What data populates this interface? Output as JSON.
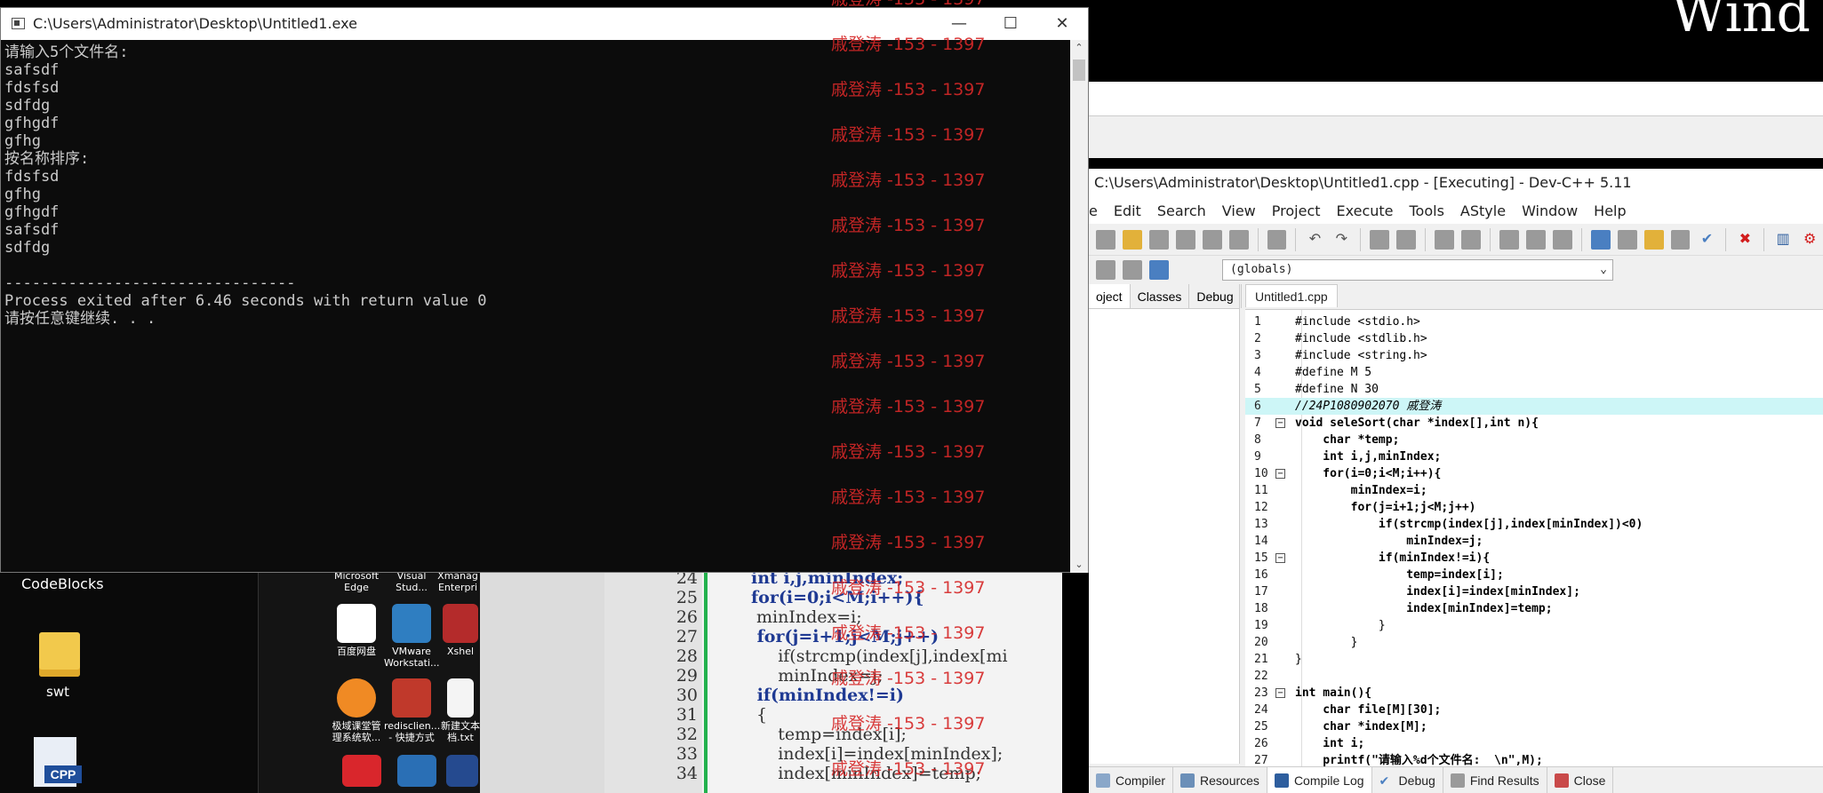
{
  "console": {
    "title": "C:\\Users\\Administrator\\Desktop\\Untitled1.exe",
    "lines": [
      "请输入5个文件名:",
      "safsdf",
      "fdsfsd",
      "sdfdg",
      "gfhgdf",
      "gfhg",
      "按名称排序:",
      "fdsfsd",
      "gfhg",
      "gfhgdf",
      "safsdf",
      "sdfdg",
      "",
      "--------------------------------",
      "Process exited after 6.46 seconds with return value 0",
      "请按任意键继续. . ."
    ],
    "minimize": "—",
    "maximize": "☐",
    "close": "✕"
  },
  "watermark": {
    "text": "戚登涛 -153 - 1397"
  },
  "devcpp": {
    "title": "C:\\Users\\Administrator\\Desktop\\Untitled1.cpp - [Executing] - Dev-C++ 5.11",
    "menu": [
      "e",
      "Edit",
      "Search",
      "View",
      "Project",
      "Execute",
      "Tools",
      "AStyle",
      "Window",
      "Help"
    ],
    "globals": "(globals)",
    "left_tabs": [
      "oject",
      "Classes",
      "Debug"
    ],
    "file_tab": "Untitled1.cpp",
    "code": [
      {
        "n": "1",
        "t": "#include <stdio.h>",
        "cls": "pp"
      },
      {
        "n": "2",
        "t": "#include <stdlib.h>",
        "cls": "pp"
      },
      {
        "n": "3",
        "t": "#include <string.h>",
        "cls": "pp"
      },
      {
        "n": "4",
        "t": "#define M 5",
        "cls": "pp"
      },
      {
        "n": "5",
        "t": "#define N 30",
        "cls": "pp"
      },
      {
        "n": "6",
        "t": "//24P1080902070 戚登涛",
        "cls": "cm"
      },
      {
        "n": "7",
        "t": "void seleSort(char *index[],int n){",
        "cls": "kw"
      },
      {
        "n": "8",
        "t": "    char *temp;",
        "cls": "kw"
      },
      {
        "n": "9",
        "t": "    int i,j,minIndex;",
        "cls": "kw"
      },
      {
        "n": "10",
        "t": "    for(i=0;i<M;i++){",
        "cls": "kw"
      },
      {
        "n": "11",
        "t": "        minIndex=i;",
        "cls": "kw"
      },
      {
        "n": "12",
        "t": "        for(j=i+1;j<M;j++)",
        "cls": "kw"
      },
      {
        "n": "13",
        "t": "            if(strcmp(index[j],index[minIndex])<0)",
        "cls": "kw"
      },
      {
        "n": "14",
        "t": "                minIndex=j;",
        "cls": "kw"
      },
      {
        "n": "15",
        "t": "            if(minIndex!=i){",
        "cls": "kw"
      },
      {
        "n": "16",
        "t": "                temp=index[i];",
        "cls": "kw"
      },
      {
        "n": "17",
        "t": "                index[i]=index[minIndex];",
        "cls": "kw"
      },
      {
        "n": "18",
        "t": "                index[minIndex]=temp;",
        "cls": "kw"
      },
      {
        "n": "19",
        "t": "            }",
        "cls": "op"
      },
      {
        "n": "20",
        "t": "        }",
        "cls": "op"
      },
      {
        "n": "21",
        "t": "}",
        "cls": "op"
      },
      {
        "n": "22",
        "t": "",
        "cls": "kw"
      },
      {
        "n": "23",
        "t": "int main(){",
        "cls": "kw"
      },
      {
        "n": "24",
        "t": "    char file[M][30];",
        "cls": "kw"
      },
      {
        "n": "25",
        "t": "    char *index[M];",
        "cls": "kw"
      },
      {
        "n": "26",
        "t": "    int i;",
        "cls": "kw"
      },
      {
        "n": "27",
        "t": "    printf(\"请输入%d个文件名:  \\n\",M);",
        "cls": "kw"
      }
    ],
    "bottom_tabs": [
      "Compiler",
      "Resources",
      "Compile Log",
      "Debug",
      "Find Results",
      "Close"
    ]
  },
  "desktop": {
    "codeblocks": "CodeBlocks",
    "swt": "swt",
    "icons": [
      {
        "label": "Microsoft Edge"
      },
      {
        "label": "Visual Stud..."
      },
      {
        "label": "Xmanag Enterpri"
      },
      {
        "label": "百度网盘"
      },
      {
        "label": "VMware Workstati..."
      },
      {
        "label": "Xshel"
      },
      {
        "label": "极域课堂管理系统软..."
      },
      {
        "label": "redisclien... - 快捷方式"
      },
      {
        "label": "新建文本档.txt"
      }
    ],
    "cpp_badge": "CPP"
  },
  "bigcode": {
    "lines": [
      {
        "n": "24",
        "t": "int i,j,minIndex;"
      },
      {
        "n": "25",
        "t": "for(i=0;i<M;i++){"
      },
      {
        "n": "26",
        "t": " minIndex=i;"
      },
      {
        "n": "27",
        "t": " for(j=i+1;j<M;j++)"
      },
      {
        "n": "28",
        "t": "     if(strcmp(index[j],index[mi"
      },
      {
        "n": "29",
        "t": "     minIndex=j;"
      },
      {
        "n": "30",
        "t": " if(minIndex!=i)"
      },
      {
        "n": "31",
        "t": " {"
      },
      {
        "n": "32",
        "t": "     temp=index[i];"
      },
      {
        "n": "33",
        "t": "     index[i]=index[minIndex];"
      },
      {
        "n": "34",
        "t": "     index[minIndex]=temp;"
      }
    ]
  },
  "wind_text": "Wind"
}
